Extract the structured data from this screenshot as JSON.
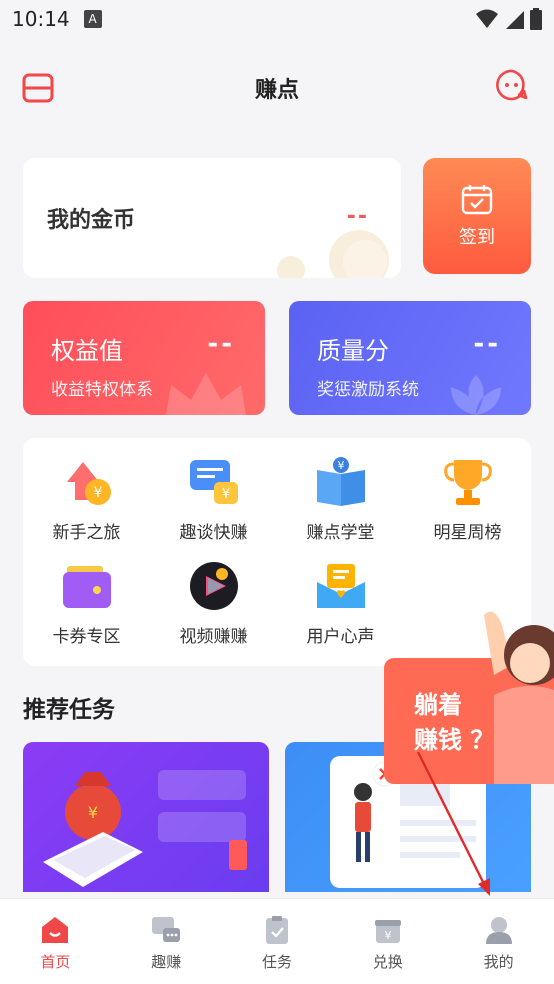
{
  "status_bar": {
    "time": "10:14",
    "a_label": "A"
  },
  "header": {
    "title": "赚点"
  },
  "coins": {
    "label": "我的金币",
    "value": "--"
  },
  "checkin": {
    "label": "签到"
  },
  "stats": [
    {
      "title": "权益值",
      "value": "--",
      "subtitle": "收益特权体系"
    },
    {
      "title": "质量分",
      "value": "--",
      "subtitle": "奖惩激励系统"
    }
  ],
  "grid": [
    {
      "label": "新手之旅",
      "icon": "arrow-coin-icon"
    },
    {
      "label": "趣谈快赚",
      "icon": "chat-coin-icon"
    },
    {
      "label": "赚点学堂",
      "icon": "book-icon"
    },
    {
      "label": "明星周榜",
      "icon": "trophy-icon"
    },
    {
      "label": "卡券专区",
      "icon": "wallet-icon"
    },
    {
      "label": "视频赚赚",
      "icon": "video-coin-icon"
    },
    {
      "label": "用户心声",
      "icon": "mailbox-icon"
    }
  ],
  "section": {
    "title": "推荐任务"
  },
  "float_ad": {
    "line1": "躺着",
    "line2": "赚钱 ？"
  },
  "tabs": [
    {
      "label": "首页",
      "active": true
    },
    {
      "label": "趣赚",
      "active": false
    },
    {
      "label": "任务",
      "active": false
    },
    {
      "label": "兑换",
      "active": false
    },
    {
      "label": "我的",
      "active": false
    }
  ],
  "colors": {
    "accent": "#f04848",
    "orange": "#ff6d45",
    "red_card": "#ff4e5a",
    "blue_card": "#5b62f2"
  }
}
